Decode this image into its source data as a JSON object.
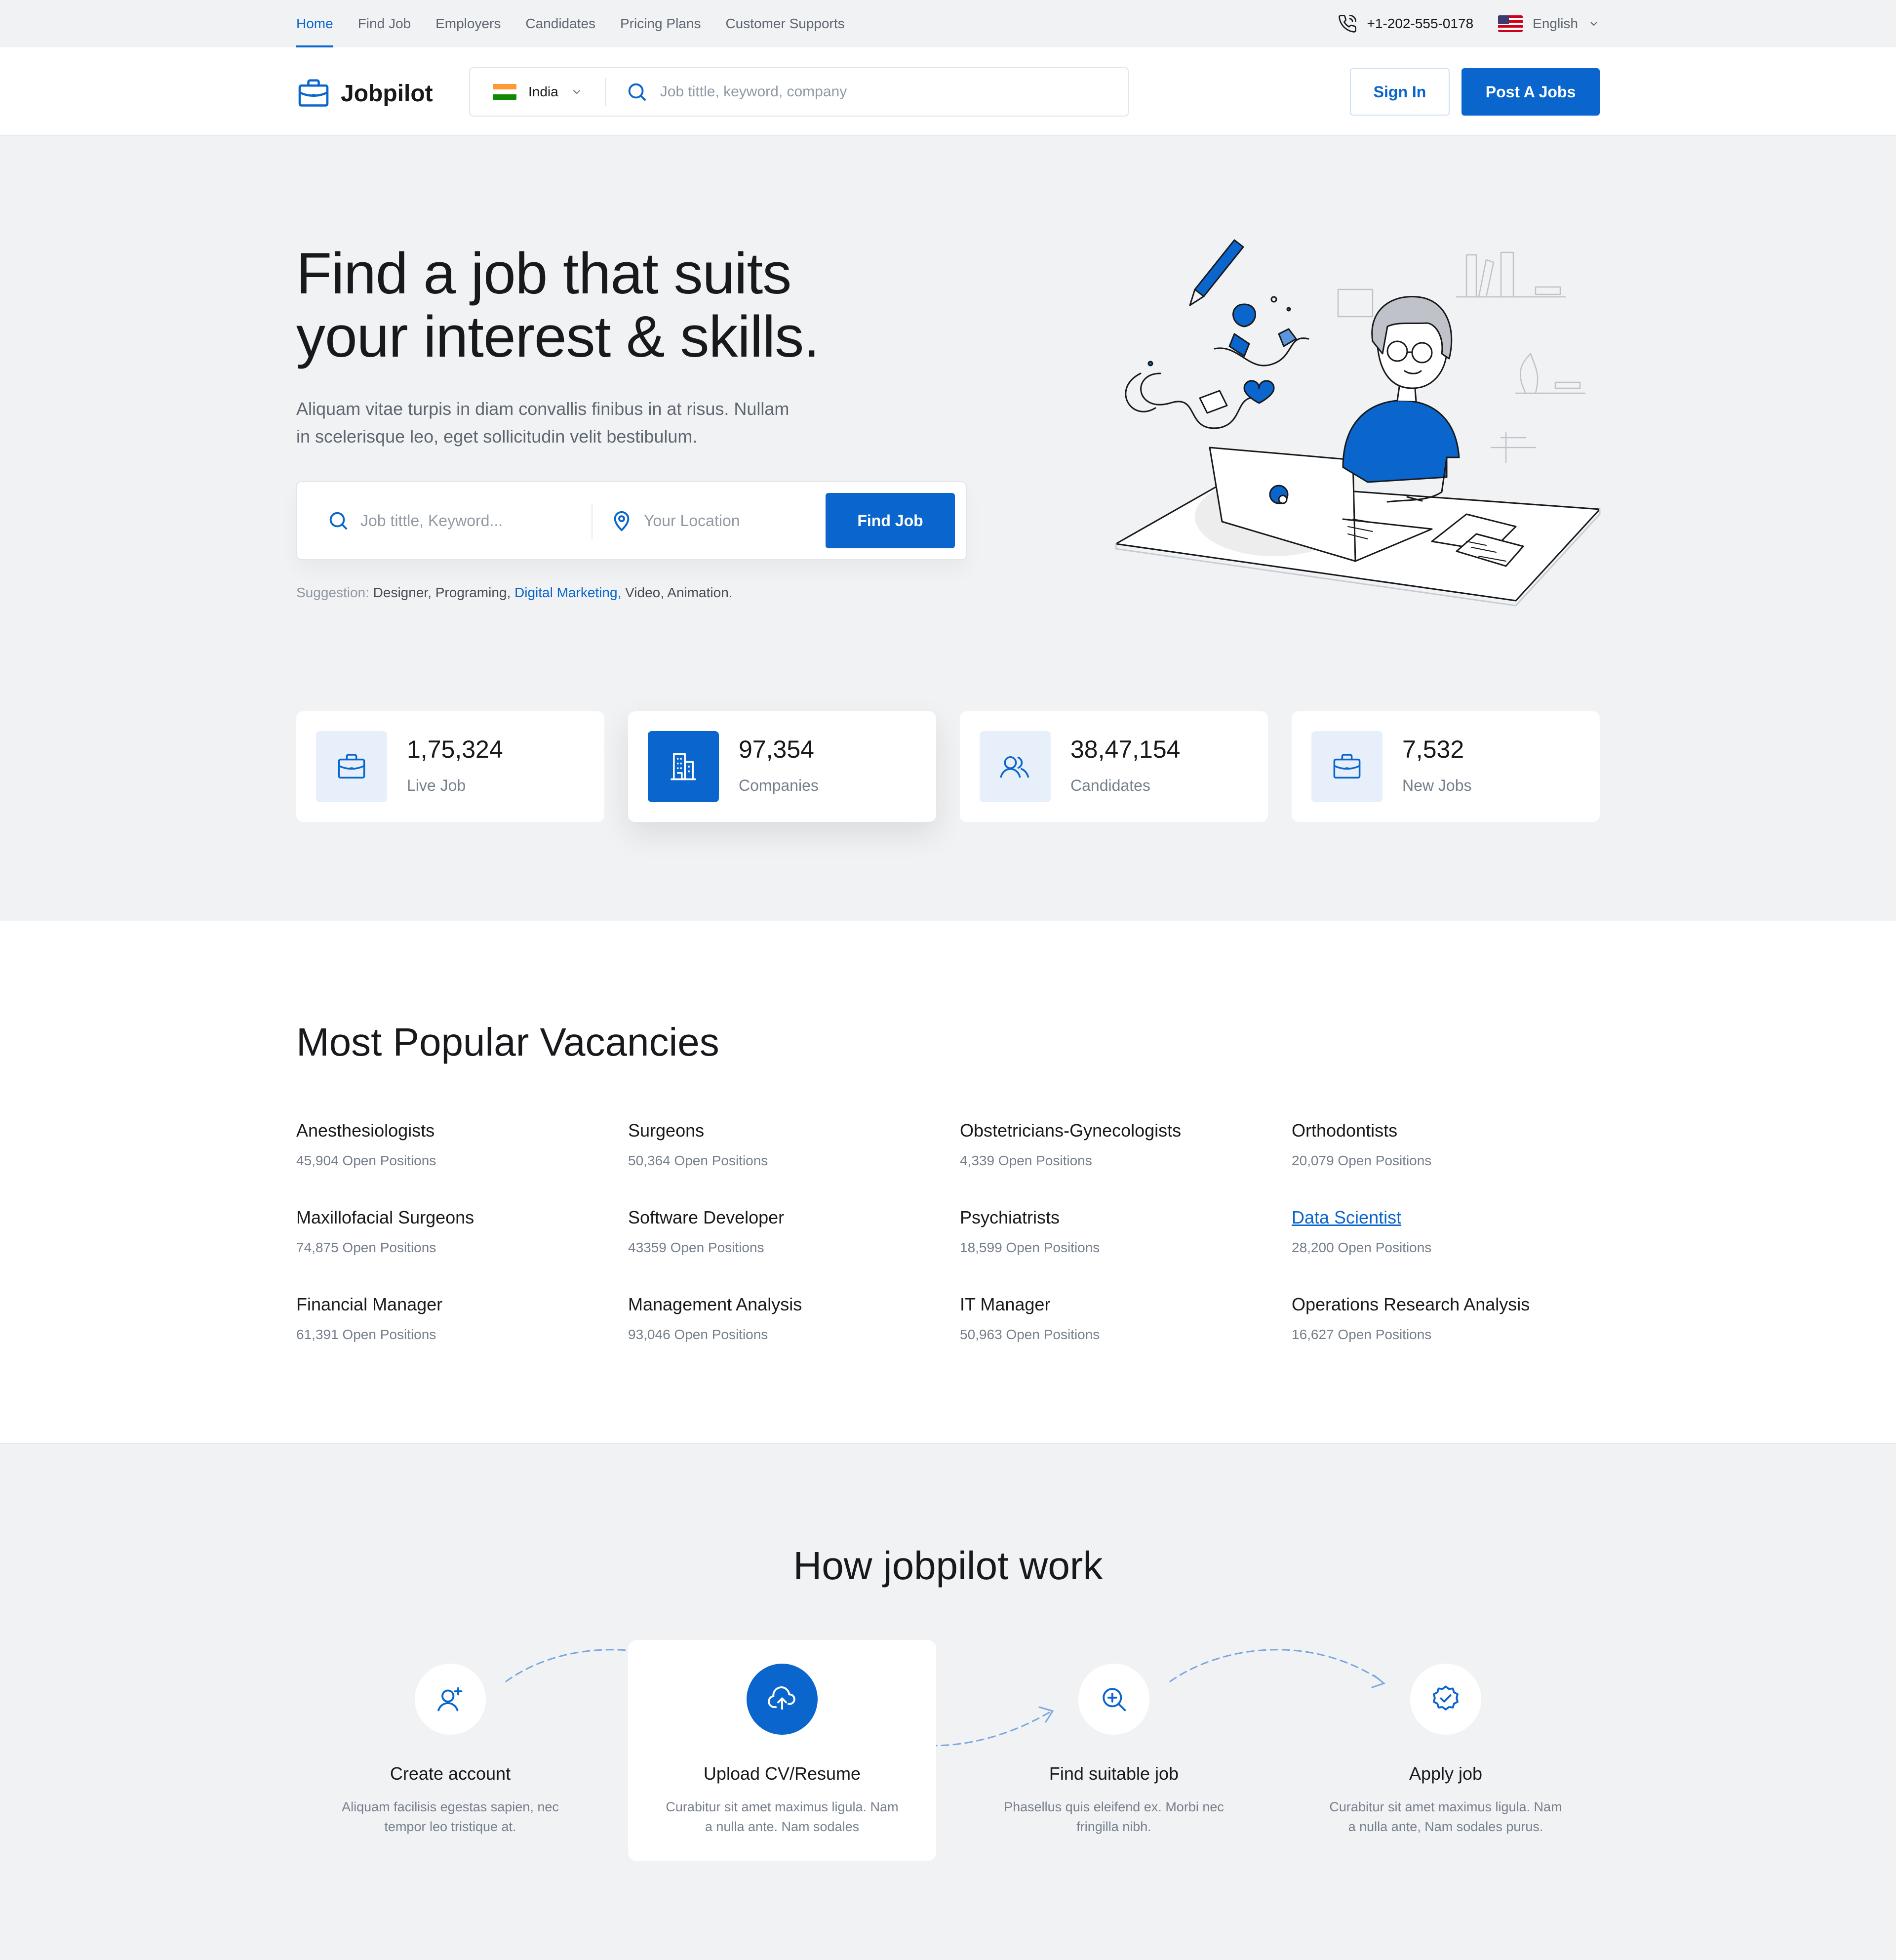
{
  "topnav": {
    "links": [
      "Home",
      "Find Job",
      "Employers",
      "Candidates",
      "Pricing Plans",
      "Customer Supports"
    ],
    "active": "Home",
    "phone": "+1-202-555-0178",
    "language": "English"
  },
  "header": {
    "logo": "Jobpilot",
    "country": "India",
    "search_placeholder": "Job tittle, keyword, company",
    "signin": "Sign In",
    "post_job": "Post A Jobs"
  },
  "hero": {
    "title_line1": "Find a job that suits",
    "title_line2": "your interest & skills.",
    "subtitle_line1": "Aliquam vitae turpis in diam convallis finibus in at risus. Nullam",
    "subtitle_line2": "in scelerisque leo, eget sollicitudin velit bestibulum.",
    "keyword_placeholder": "Job tittle, Keyword...",
    "location_placeholder": "Your Location",
    "find_button": "Find Job",
    "suggestion_label": "Suggestion:",
    "suggestions": [
      "Designer,",
      "Programing,",
      "Digital Marketing,",
      "Video,",
      "Animation."
    ]
  },
  "stats": [
    {
      "value": "1,75,324",
      "label": "Live Job",
      "icon": "briefcase-icon"
    },
    {
      "value": "97,354",
      "label": "Companies",
      "icon": "building-icon"
    },
    {
      "value": "38,47,154",
      "label": "Candidates",
      "icon": "users-icon"
    },
    {
      "value": "7,532",
      "label": "New Jobs",
      "icon": "briefcase-icon"
    }
  ],
  "vacancies": {
    "title": "Most Popular Vacancies",
    "items": [
      {
        "title": "Anesthesiologists",
        "count": "45,904 Open Positions"
      },
      {
        "title": "Surgeons",
        "count": "50,364 Open Positions"
      },
      {
        "title": "Obstetricians-Gynecologists",
        "count": "4,339 Open Positions"
      },
      {
        "title": "Orthodontists",
        "count": "20,079 Open Positions"
      },
      {
        "title": "Maxillofacial Surgeons",
        "count": "74,875 Open Positions"
      },
      {
        "title": "Software Developer",
        "count": "43359 Open Positions"
      },
      {
        "title": "Psychiatrists",
        "count": "18,599 Open Positions"
      },
      {
        "title": "Data Scientist",
        "count": "28,200 Open Positions"
      },
      {
        "title": "Financial Manager",
        "count": "61,391 Open Positions"
      },
      {
        "title": "Management Analysis",
        "count": "93,046 Open Positions"
      },
      {
        "title": "IT Manager",
        "count": "50,963 Open Positions"
      },
      {
        "title": "Operations Research Analysis",
        "count": "16,627 Open Positions"
      }
    ]
  },
  "how": {
    "title": "How jobpilot work",
    "steps": [
      {
        "title": "Create account",
        "desc_line1": "Aliquam facilisis egestas sapien, nec",
        "desc_line2": "tempor leo tristique at.",
        "icon": "user-add-icon"
      },
      {
        "title": "Upload CV/Resume",
        "desc_line1": "Curabitur sit amet maximus ligula. Nam",
        "desc_line2": "a nulla ante. Nam sodales",
        "icon": "cloud-upload-icon"
      },
      {
        "title": "Find suitable job",
        "desc_line1": "Phasellus quis eleifend ex. Morbi nec",
        "desc_line2": "fringilla nibh.",
        "icon": "search-plus-icon"
      },
      {
        "title": "Apply job",
        "desc_line1": "Curabitur sit amet maximus ligula. Nam",
        "desc_line2": "a nulla ante, Nam sodales purus.",
        "icon": "badge-check-icon"
      }
    ]
  },
  "colors": {
    "primary": "#0a65cc",
    "light_bg": "#f1f2f4",
    "icon_bg": "#e7f0fa"
  }
}
